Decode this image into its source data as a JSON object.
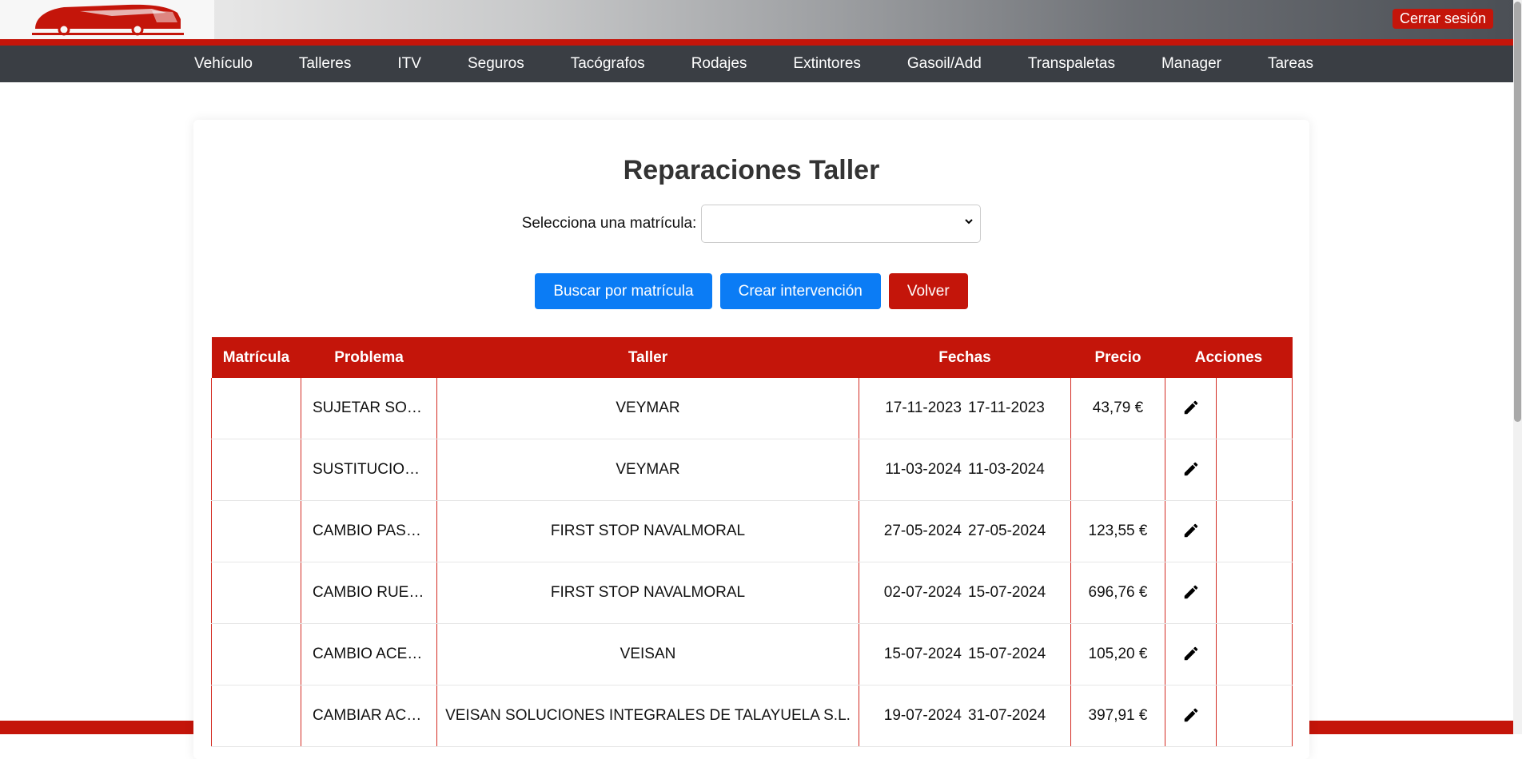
{
  "header": {
    "logout_label": "Cerrar sesión"
  },
  "nav": {
    "items": [
      "Vehículo",
      "Talleres",
      "ITV",
      "Seguros",
      "Tacógrafos",
      "Rodajes",
      "Extintores",
      "Gasoil/Add",
      "Transpaletas",
      "Manager",
      "Tareas"
    ]
  },
  "main": {
    "title": "Reparaciones Taller",
    "select_label": "Selecciona una matrícula:",
    "select_value": "",
    "buttons": {
      "search": "Buscar por matrícula",
      "create": "Crear intervención",
      "back": "Volver"
    }
  },
  "table": {
    "headers": [
      "Matrícula",
      "Problema",
      "Taller",
      "Fechas",
      "Precio",
      "Acciones"
    ],
    "rows": [
      {
        "matricula": "",
        "problema": "SUJETAR SO…",
        "taller": "VEYMAR",
        "fecha_inicio": "17-11-2023",
        "fecha_fin": "17-11-2023",
        "precio": "43,79 €"
      },
      {
        "matricula": "",
        "problema": "SUSTITUCIO…",
        "taller": "VEYMAR",
        "fecha_inicio": "11-03-2024",
        "fecha_fin": "11-03-2024",
        "precio": ""
      },
      {
        "matricula": "",
        "problema": "CAMBIO PAS…",
        "taller": "FIRST STOP NAVALMORAL",
        "fecha_inicio": "27-05-2024",
        "fecha_fin": "27-05-2024",
        "precio": "123,55 €"
      },
      {
        "matricula": "",
        "problema": "CAMBIO RUE…",
        "taller": "FIRST STOP NAVALMORAL",
        "fecha_inicio": "02-07-2024",
        "fecha_fin": "15-07-2024",
        "precio": "696,76 €"
      },
      {
        "matricula": "",
        "problema": "CAMBIO ACE…",
        "taller": "VEISAN",
        "fecha_inicio": "15-07-2024",
        "fecha_fin": "15-07-2024",
        "precio": "105,20 €"
      },
      {
        "matricula": "",
        "problema": "CAMBIAR AC…",
        "taller": "VEISAN SOLUCIONES INTEGRALES DE TALAYUELA S.L.",
        "fecha_inicio": "19-07-2024",
        "fecha_fin": "31-07-2024",
        "precio": "397,91 €"
      }
    ]
  },
  "colors": {
    "brand_red": "#c4150a",
    "nav_dark": "#3a3e44",
    "button_blue": "#0b7cf5"
  },
  "icons": {
    "logo": "bus-logo-icon",
    "edit": "pencil-icon"
  }
}
